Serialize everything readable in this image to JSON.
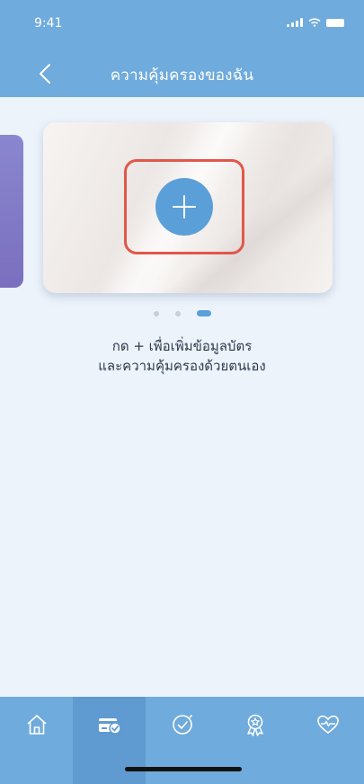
{
  "status_bar": {
    "time": "9:41"
  },
  "nav": {
    "title": "ความคุ้มครองของฉัน"
  },
  "card": {
    "add_symbol": "+"
  },
  "carousel": {
    "page_count": 3,
    "active_index": 2
  },
  "hint": {
    "line1": "กด + เพื่อเพิ่มข้อมูลบัตร",
    "line2": "และความคุ้มครองด้วยตนเอง"
  },
  "tab_bar": {
    "active_index": 1,
    "tabs": [
      {
        "icon": "home-icon"
      },
      {
        "icon": "card-check-icon"
      },
      {
        "icon": "clock-check-icon"
      },
      {
        "icon": "award-icon"
      },
      {
        "icon": "heart-pulse-icon"
      }
    ]
  },
  "colors": {
    "brand_blue": "#6fabdc",
    "button_blue": "#5b9fd9",
    "highlight_red": "#e2574a",
    "background": "#ecf3fb"
  }
}
